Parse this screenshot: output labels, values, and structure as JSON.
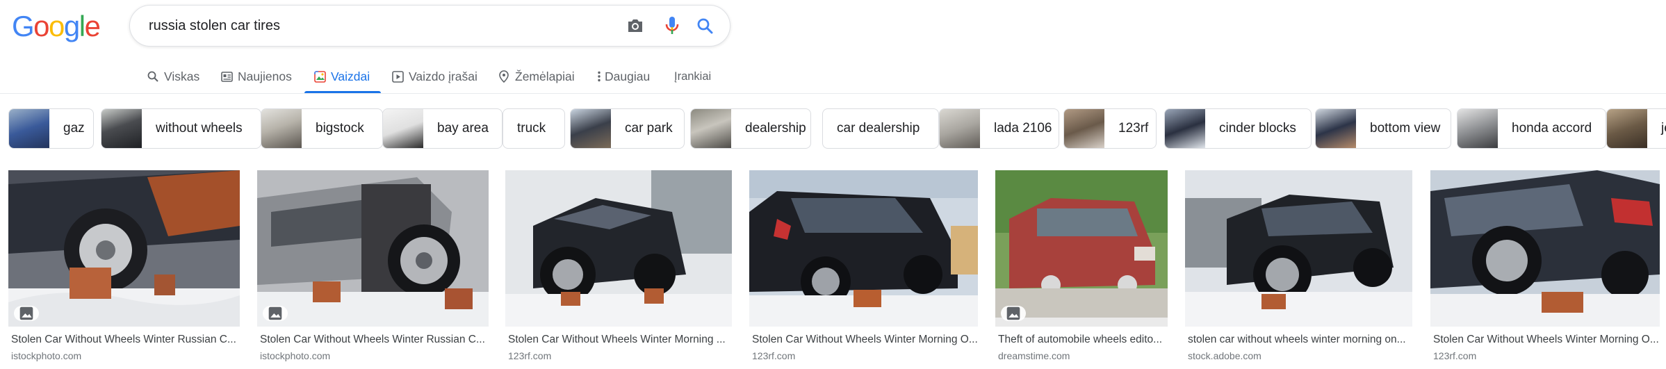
{
  "logo": {
    "letters": [
      "G",
      "o",
      "o",
      "g",
      "l",
      "e"
    ],
    "colors": [
      "#4285f4",
      "#ea4335",
      "#fbbc05",
      "#4285f4",
      "#34a853",
      "#ea4335"
    ]
  },
  "search": {
    "query": "russia stolen car tires",
    "camera_icon": "camera-icon",
    "mic_icon": "microphone-icon",
    "search_icon": "search-icon"
  },
  "tabs": [
    {
      "label": "Viskas",
      "icon": "search-icon",
      "active": false
    },
    {
      "label": "Naujienos",
      "icon": "newspaper-icon",
      "active": false
    },
    {
      "label": "Vaizdai",
      "icon": "image-icon",
      "active": true
    },
    {
      "label": "Vaizdo įrašai",
      "icon": "play-icon",
      "active": false
    },
    {
      "label": "Žemėlapiai",
      "icon": "map-pin-icon",
      "active": false
    },
    {
      "label": "Daugiau",
      "icon": "more-vert-icon",
      "active": false
    },
    {
      "label": "Įrankiai",
      "icon": "",
      "active": false
    }
  ],
  "chips": [
    {
      "label": "gaz",
      "has_thumb": true
    },
    {
      "label": "without wheels",
      "has_thumb": true
    },
    {
      "label": "bigstock",
      "has_thumb": true
    },
    {
      "label": "bay area",
      "has_thumb": true
    },
    {
      "label": "truck",
      "has_thumb": false
    },
    {
      "label": "car park",
      "has_thumb": true
    },
    {
      "label": "dealership",
      "has_thumb": true
    },
    {
      "label": "car dealership",
      "has_thumb": false
    },
    {
      "label": "lada 2106",
      "has_thumb": true
    },
    {
      "label": "123rf",
      "has_thumb": true
    },
    {
      "label": "cinder blocks",
      "has_thumb": true
    },
    {
      "label": "bottom view",
      "has_thumb": true
    },
    {
      "label": "honda accord",
      "has_thumb": true
    },
    {
      "label": "je",
      "has_thumb": true
    }
  ],
  "results": [
    {
      "title": "Stolen Car Without Wheels Winter Russian C...",
      "source": "istockphoto.com",
      "badge": true
    },
    {
      "title": "Stolen Car Without Wheels Winter Russian C...",
      "source": "istockphoto.com",
      "badge": true
    },
    {
      "title": "Stolen Car Without Wheels Winter Morning ...",
      "source": "123rf.com",
      "badge": false
    },
    {
      "title": "Stolen Car Without Wheels Winter Morning O...",
      "source": "123rf.com",
      "badge": false
    },
    {
      "title": "Theft of automobile wheels edito...",
      "source": "dreamstime.com",
      "badge": true
    },
    {
      "title": "stolen car without wheels winter morning on...",
      "source": "stock.adobe.com",
      "badge": false
    },
    {
      "title": "Stolen Car Without Wheels Winter Morning O...",
      "source": "123rf.com",
      "badge": false
    }
  ],
  "colors": {
    "accent": "#1a73e8",
    "text_secondary": "#5f6368",
    "source_text": "#70757a"
  }
}
